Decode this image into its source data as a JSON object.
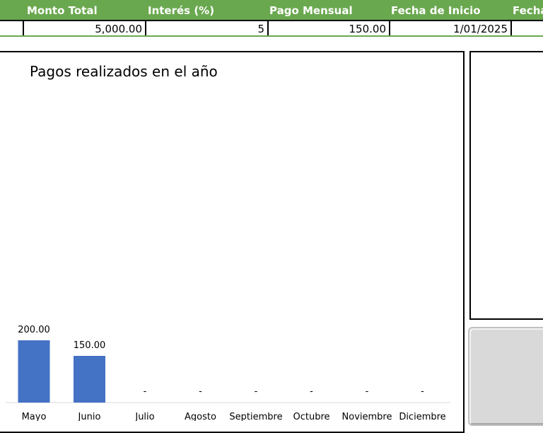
{
  "table": {
    "headers": [
      "Monto Total",
      "Interés (%)",
      "Pago Mensual",
      "Fecha de Inicio",
      "Fecha"
    ],
    "values": [
      "5,000.00",
      "5",
      "150.00",
      "1/01/2025"
    ]
  },
  "chart_data": {
    "type": "bar",
    "title": "Pagos realizados en el año",
    "categories": [
      "Mayo",
      "Junio",
      "Julio",
      "Agosto",
      "Septiembre",
      "Octubre",
      "Noviembre",
      "Diciembre"
    ],
    "values": [
      200,
      150,
      0,
      0,
      0,
      0,
      0,
      0
    ],
    "data_labels": [
      "200.00",
      "150.00",
      "-",
      "-",
      "-",
      "-",
      "-",
      "-"
    ],
    "bar_color": "#4472c4",
    "grid": false
  }
}
